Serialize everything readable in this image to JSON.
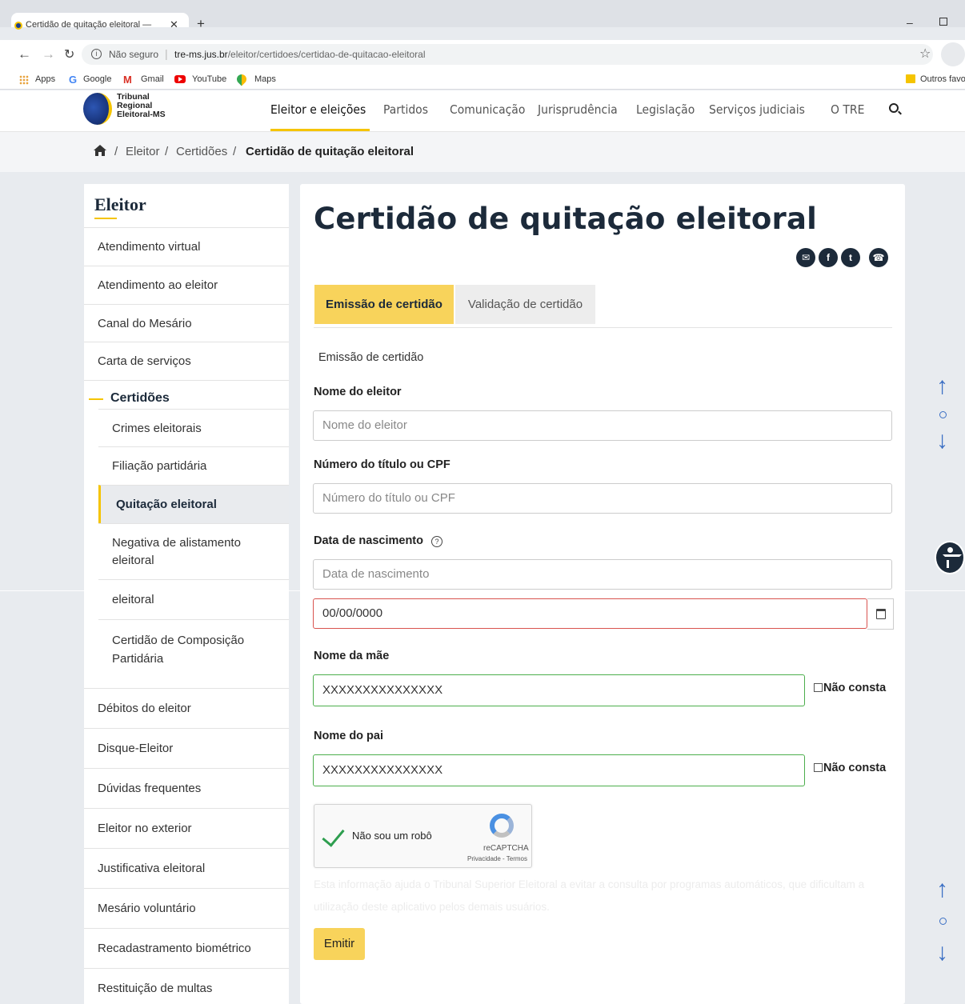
{
  "browser": {
    "tab_title": "Certidão de quitação eleitoral —",
    "tab_close": "✕",
    "new_tab": "+",
    "not_secure": "Não seguro",
    "url_host": "tre-ms.jus.br",
    "url_path": "/eleitor/certidoes/certidao-de-quitacao-eleitoral",
    "bookmarks": [
      "Apps",
      "Google",
      "Gmail",
      "YouTube",
      "Maps"
    ],
    "other_bookmarks": "Outros favo"
  },
  "site": {
    "logo_lines": [
      "Tribunal",
      "Regional",
      "Eleitoral-MS"
    ],
    "nav": [
      "Eleitor e eleições",
      "Partidos",
      "Comunicação",
      "Jurisprudência",
      "Legislação",
      "Serviços judiciais",
      "O TRE"
    ],
    "breadcrumb": [
      "Eleitor",
      "Certidões",
      "Certidão de quitação eleitoral"
    ]
  },
  "sidebar": {
    "title": "Eleitor",
    "items_top": [
      "Atendimento virtual",
      "Atendimento ao eleitor",
      "Canal do Mesário",
      "Carta de serviços"
    ],
    "group": "Certidões",
    "sub_items": [
      "Crimes eleitorais",
      "Filiação partidária",
      "Quitação eleitoral",
      "Negativa de alistamento eleitoral",
      "eleitoral",
      "Certidão de Composição Partidária"
    ],
    "active_sub": "Quitação eleitoral",
    "items_bottom": [
      "Débitos do eleitor",
      "Disque-Eleitor",
      "Dúvidas frequentes",
      "Eleitor no exterior",
      "Justificativa eleitoral",
      "Mesário voluntário",
      "Recadastramento biométrico",
      "Restituição de multas"
    ]
  },
  "main": {
    "title": "Certidão de quitação eleitoral",
    "share_icons": [
      "envelope-icon",
      "facebook-icon",
      "twitter-icon",
      "whatsapp-icon"
    ],
    "tabs": [
      "Emissão de certidão",
      "Validação de certidão"
    ],
    "section_label": "Emissão de certidão",
    "form": {
      "nome_label": "Nome do eleitor",
      "nome_placeholder": "Nome do eleitor",
      "titulo_label": "Número do título ou CPF",
      "titulo_placeholder": "Número do título ou CPF",
      "nascimento_label": "Data de nascimento",
      "nascimento_placeholder": "Data de nascimento",
      "nascimento_value": "00/00/0000",
      "mae_label": "Nome da mãe",
      "mae_value": "XXXXXXXXXXXXXXX",
      "pai_label": "Nome do pai",
      "pai_value": "XXXXXXXXXXXXXXX",
      "nao_consta": "Não consta",
      "captcha_label": "Não sou um robô",
      "recaptcha": "reCAPTCHA",
      "recaptcha_links": "Privacidade - Termos",
      "hint": "Esta informação ajuda o Tribunal Superior Eleitoral a evitar a consulta por programas automáticos, que dificultam a utilização deste aplicativo pelos demais usuários.",
      "submit": "Emitir"
    }
  },
  "colors": {
    "accent_yellow": "#f8d35b",
    "navy": "#1c2a3a",
    "valid_green": "#4cae4c",
    "invalid_red": "#d9534f"
  }
}
